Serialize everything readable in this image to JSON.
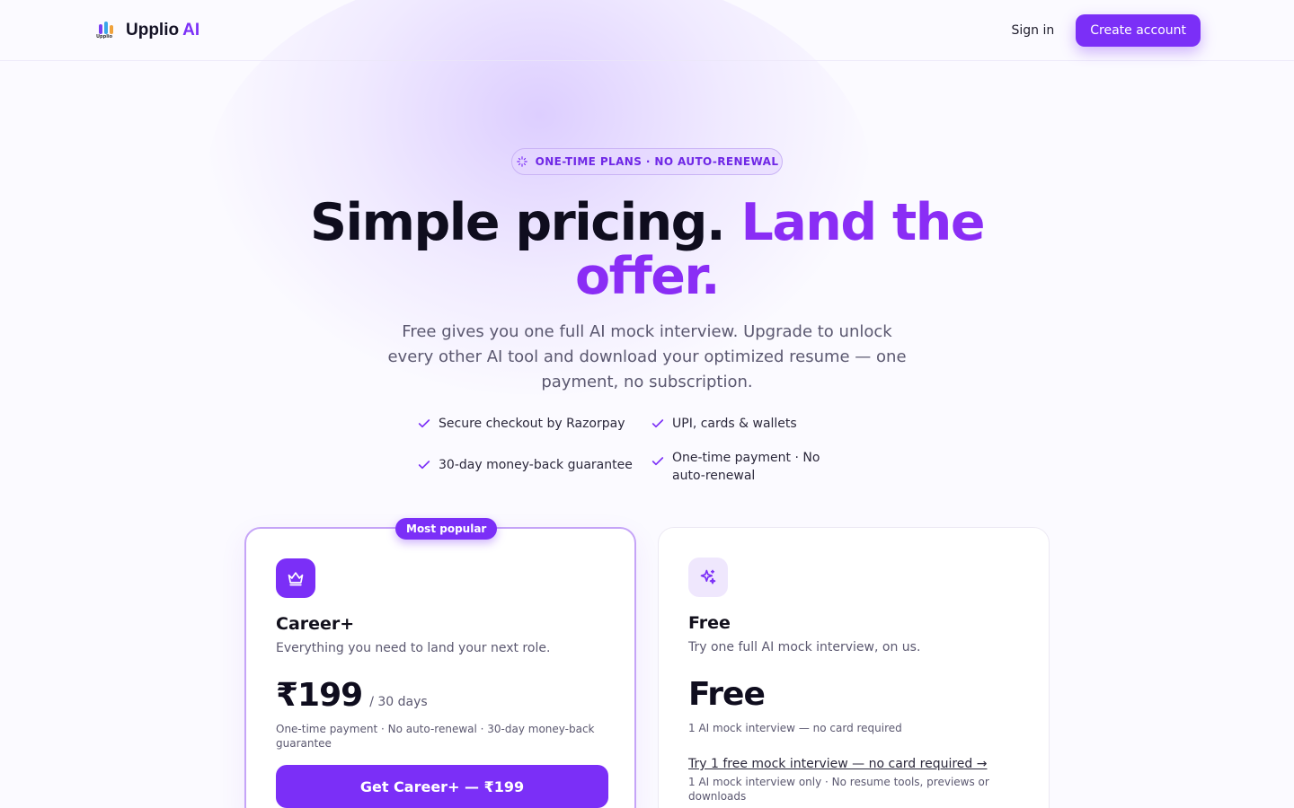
{
  "header": {
    "brand_name": "Upplio",
    "brand_accent": "AI",
    "logo_text": "Upplio",
    "signin_label": "Sign in",
    "create_label": "Create account"
  },
  "hero": {
    "pill_label": "ONE-TIME PLANS · NO AUTO-RENEWAL",
    "title_main": "Simple pricing.",
    "title_accent": "Land the offer.",
    "subtitle": "Free gives you one full AI mock interview. Upgrade to unlock every other AI tool and download your optimized resume — one payment, no subscription.",
    "features": [
      "Secure checkout by Razorpay",
      "UPI, cards & wallets",
      "30-day money-back guarantee",
      "One-time payment · No auto-renewal"
    ]
  },
  "plans": {
    "career": {
      "badge": "Most popular",
      "name": "Career+",
      "description": "Everything you need to land your next role.",
      "price": "₹199",
      "period": "/ 30 days",
      "fine_print": "One-time payment · No auto-renewal · 30-day money-back guarantee",
      "cta_label": "Get Career+ — ₹199",
      "icon": "crown-icon"
    },
    "free": {
      "name": "Free",
      "description": "Try one full AI mock interview, on us.",
      "price": "Free",
      "fine_print": "1 AI mock interview — no card required",
      "link_label": "Try 1 free mock interview — no card required →",
      "link_note": "1 AI mock interview only · No resume tools, previews or downloads",
      "icon": "sparkles-icon"
    }
  },
  "colors": {
    "accent": "#7b2ff7",
    "accent_light": "#efe7fd",
    "text": "#12101c",
    "muted": "#5b5870"
  }
}
